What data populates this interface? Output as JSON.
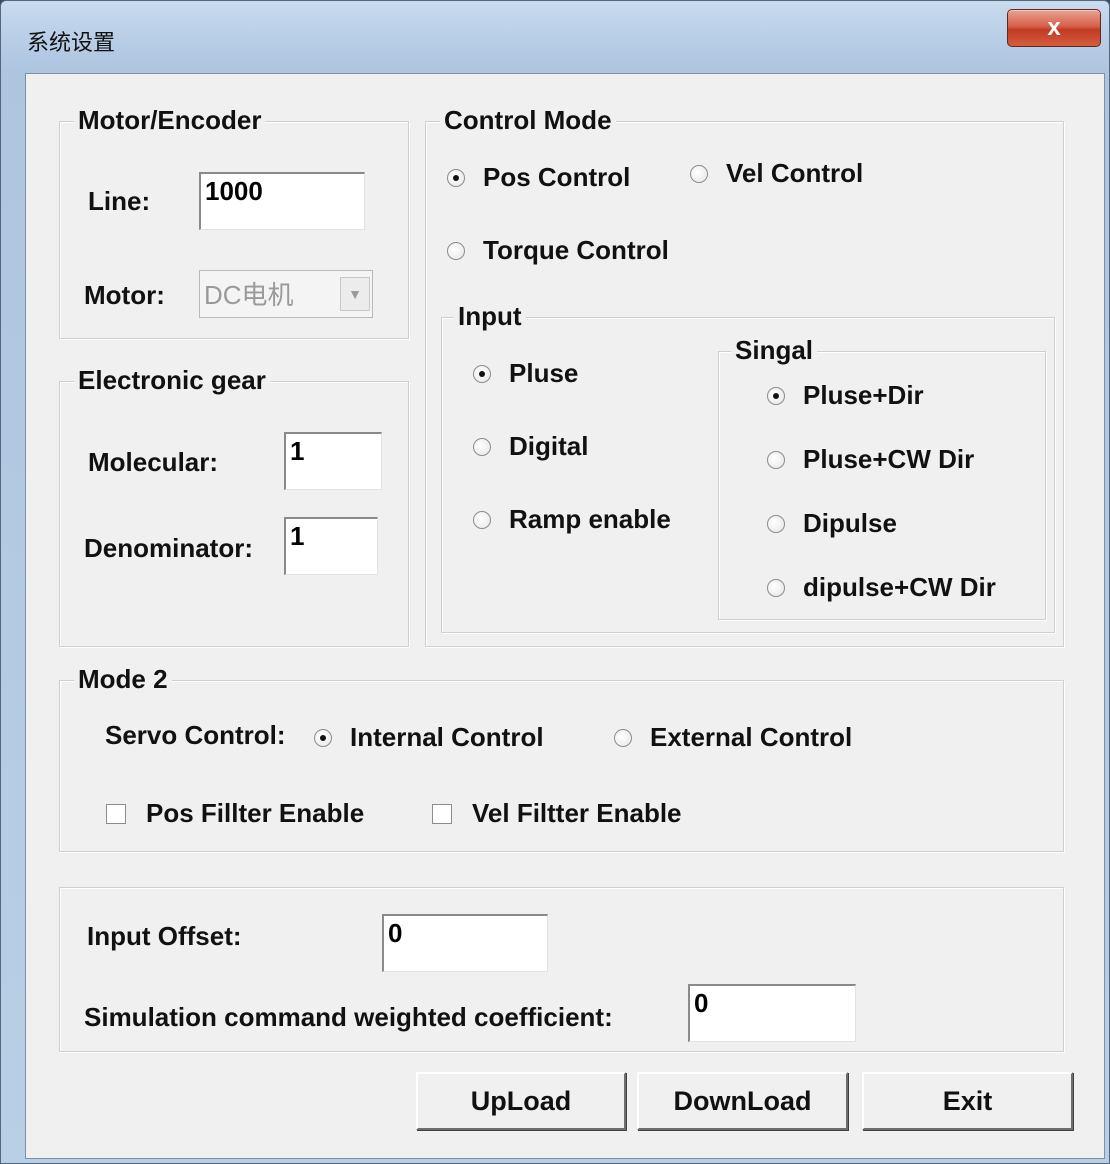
{
  "window": {
    "title": "系统设置",
    "close_label": "x"
  },
  "motor_encoder": {
    "legend": "Motor/Encoder",
    "line_label": "Line:",
    "line_value": "1000",
    "motor_label": "Motor:",
    "motor_value": "DC电机",
    "motor_arrow": "▼"
  },
  "electronic_gear": {
    "legend": "Electronic gear",
    "molecular_label": "Molecular:",
    "molecular_value": "1",
    "denominator_label": "Denominator:",
    "denominator_value": "1"
  },
  "control_mode": {
    "legend": "Control Mode",
    "pos_control": "Pos Control",
    "vel_control": "Vel Control",
    "torque_control": "Torque Control",
    "selected": "Pos Control"
  },
  "input": {
    "legend": "Input",
    "pluse": "Pluse",
    "digital": "Digital",
    "ramp_enable": "Ramp enable",
    "selected": "Pluse"
  },
  "singal": {
    "legend": "Singal",
    "pluse_dir": "Pluse+Dir",
    "pluse_cw_dir": "Pluse+CW Dir",
    "dipulse": "Dipulse",
    "dipulse_cw_dir": "dipulse+CW Dir",
    "selected": "Pluse+Dir"
  },
  "mode2": {
    "legend": "Mode 2",
    "servo_control_label": "Servo Control:",
    "internal_control": "Internal Control",
    "external_control": "External Control",
    "selected": "Internal Control",
    "pos_filter_enable": "Pos Fillter Enable",
    "vel_filter_enable": "Vel Filtter Enable",
    "pos_filter_checked": false,
    "vel_filter_checked": false
  },
  "offset": {
    "input_offset_label": "Input Offset:",
    "input_offset_value": "0",
    "sim_coeff_label": "Simulation command weighted coefficient:",
    "sim_coeff_value": "0"
  },
  "buttons": {
    "upload": "UpLoad",
    "download": "DownLoad",
    "exit": "Exit"
  }
}
